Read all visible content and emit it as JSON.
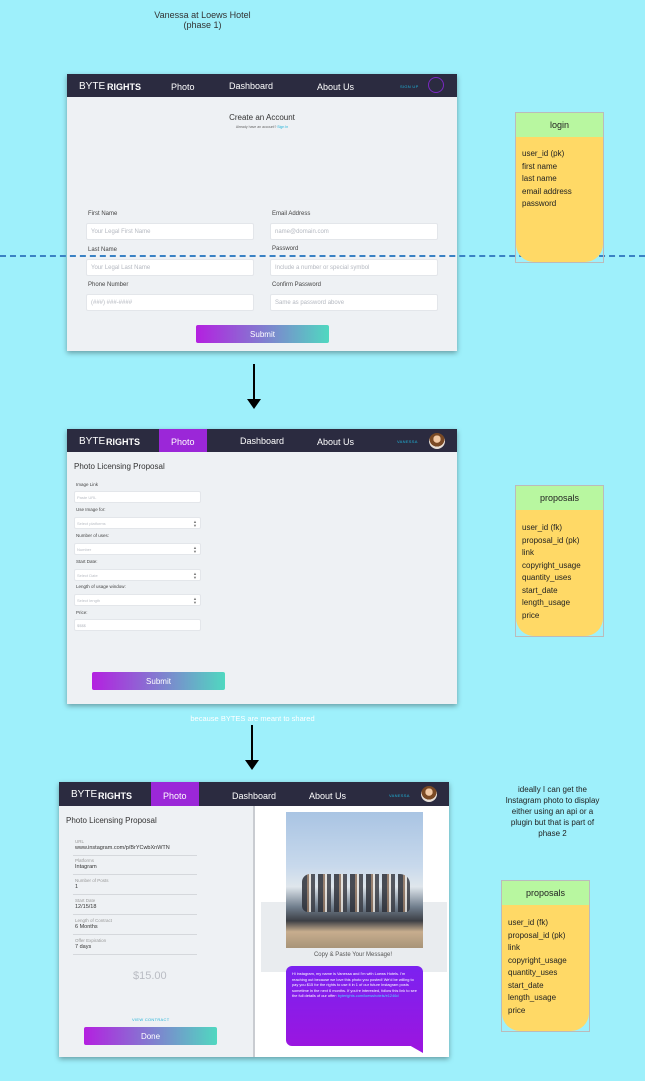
{
  "header_note": {
    "line1": "Vanessa at Loews Hotel",
    "line2": "(phase 1)"
  },
  "nav": {
    "logo_byte": "BYTE",
    "logo_rights": "RIGHTS",
    "photo": "Photo",
    "dashboard": "Dashboard",
    "about": "About Us",
    "signup": "SIGN UP",
    "user": "VANESSA"
  },
  "screen1": {
    "title": "Create an Account",
    "subtitle": "Already have an account?",
    "signin": "Sign In",
    "first_name_label": "First Name",
    "first_name_ph": "Your Legal First Name",
    "last_name_label": "Last Name",
    "last_name_ph": "Your Legal Last Name",
    "phone_label": "Phone Number",
    "phone_ph": "(###) ###-####",
    "email_label": "Email Address",
    "email_ph": "name@domain.com",
    "password_label": "Password",
    "password_ph": "Include a number or special symbol",
    "confirm_label": "Confirm Password",
    "confirm_ph": "Same as password above",
    "submit": "Submit"
  },
  "screen2": {
    "title": "Photo Licensing Proposal",
    "f1_label": "Image Link",
    "f1_ph": "Paste URL",
    "f2_label": "Use Image for:",
    "f2_ph": "Select platforms",
    "f3_label": "Number of uses:",
    "f3_ph": "Number",
    "f4_label": "Start Date:",
    "f4_ph": "Select Date",
    "f5_label": "Length of usage window:",
    "f5_ph": "Select length",
    "f6_label": "Price:",
    "f6_ph": "$$$$",
    "submit": "Submit"
  },
  "middle_note": "because BYTES are meant to shared",
  "screen3": {
    "title": "Photo Licensing Proposal",
    "url_label": "URL",
    "url_value": "www.instagram.com/p/BrYCwbXnWTN",
    "platforms_label": "Platforms",
    "platforms_value": "Intagram",
    "posts_label": "Number of Posts",
    "posts_value": "1",
    "start_label": "Start Date",
    "start_value": "12/15/18",
    "length_label": "Length of Contract",
    "length_value": "6 Months",
    "expiry_label": "Offer Expiration",
    "expiry_value": "7 days",
    "price": "$15.00",
    "view_contract": "VIEW CONTRACT",
    "done": "Done",
    "copy_paste": "Copy & Paste Your Message!",
    "message": "Hi instagram, my name is Vanessa and I'm with Loews Hotels. I'm reaching out because we love this photo you posted! We'd be willing to pay you $15 for the rights to use it in 1 of our future Instagram posts sometime in the next 6 months. If you're interested, follow this link to see the full details of our offer:",
    "message_link": "byterights.com/loewshotels/e1246d"
  },
  "side_note": {
    "line1": "ideally I can get the",
    "line2": "Instagram photo to display",
    "line3": "either using an api or a",
    "line4": "plugin but that is part of",
    "line5": "phase 2"
  },
  "entity_login": {
    "name": "login",
    "fields": [
      "user_id (pk)",
      "first name",
      "last name",
      "email address",
      "password"
    ]
  },
  "entity_proposals1": {
    "name": "proposals",
    "fields": [
      "user_id (fk)",
      "proposal_id (pk)",
      "link",
      "copyright_usage",
      "quantity_uses",
      "start_date",
      "length_usage",
      "price"
    ]
  },
  "entity_proposals2": {
    "name": "proposals",
    "fields": [
      "user_id (fk)",
      "proposal_id (pk)",
      "link",
      "copyright_usage",
      "quantity_uses",
      "start_date",
      "length_usage",
      "price"
    ]
  }
}
